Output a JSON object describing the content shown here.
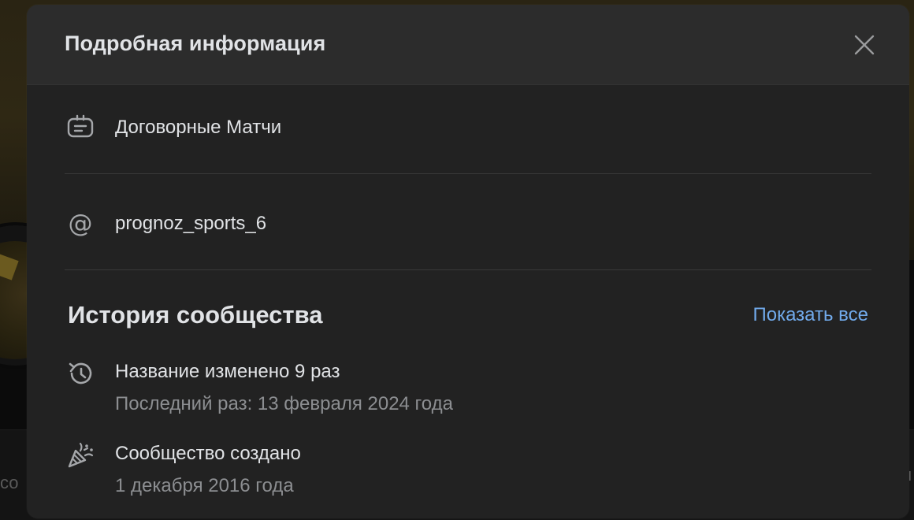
{
  "modal": {
    "title": "Подробная информация"
  },
  "info": {
    "category": "Договорные Матчи",
    "handle": "prognoz_sports_6"
  },
  "history": {
    "title": "История сообщества",
    "show_all_label": "Показать все",
    "items": [
      {
        "icon": "history-icon",
        "title": "Название изменено 9 раз",
        "subtitle": "Последний раз: 13 февраля 2024 года"
      },
      {
        "icon": "party-popper-icon",
        "title": "Сообщество создано",
        "subtitle": "1 декабря 2016 года"
      }
    ]
  },
  "background": {
    "left_text": "со",
    "right_text": "м"
  },
  "colors": {
    "modal_bg": "#222222",
    "header_bg": "#2c2c2c",
    "text_primary": "#e1e3e6",
    "text_secondary": "#8c8e91",
    "link": "#71aaeb",
    "icon": "#a5a7aa"
  }
}
